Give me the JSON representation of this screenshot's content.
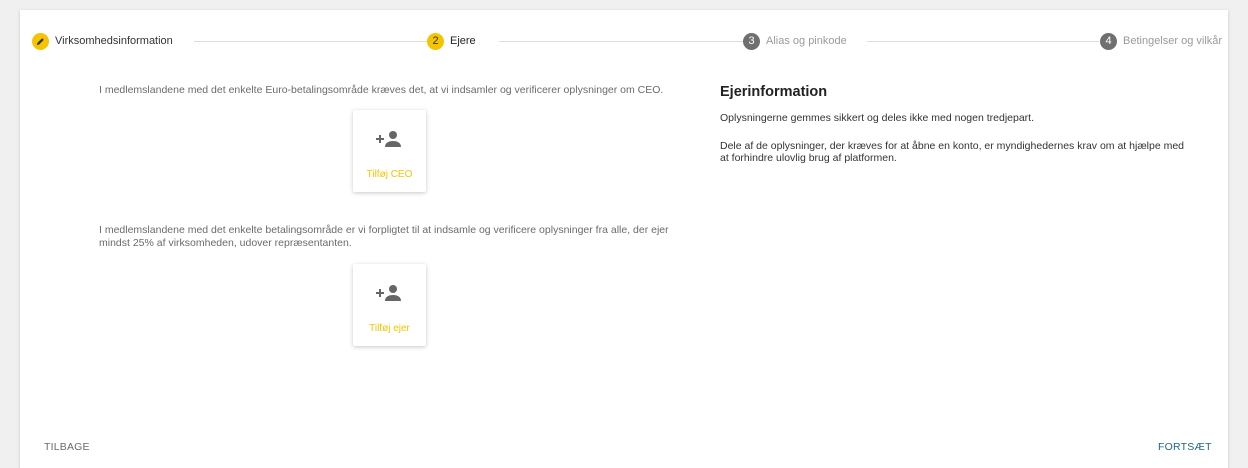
{
  "colors": {
    "accent": "#f5c400",
    "primary_action": "#1a6a80",
    "secondary_action": "#6b6b6b",
    "step_inactive": "#6f6f6f"
  },
  "stepper": {
    "steps": [
      {
        "number": "",
        "label": "Virksomhedsinformation",
        "state": "done",
        "icon": "pencil-icon"
      },
      {
        "number": "2",
        "label": "Ejere",
        "state": "active"
      },
      {
        "number": "3",
        "label": "Alias og pinkode",
        "state": "inactive"
      },
      {
        "number": "4",
        "label": "Betingelser og vilkår",
        "state": "inactive"
      }
    ]
  },
  "main": {
    "ceo_intro": "I medlemslandene med det enkelte Euro-betalingsområde kræves det, at vi indsamler og verificerer oplysninger om CEO.",
    "add_ceo_label": "Tilføj CEO",
    "owner_intro": "I medlemslandene med det enkelte betalingsområde er vi forpligtet til at indsamle og verificere oplysninger fra alle, der ejer mindst 25% af virksomheden, udover repræsentanten.",
    "add_owner_label": "Tilføj ejer",
    "add_icon": "add-person-icon"
  },
  "info": {
    "title": "Ejerinformation",
    "para1": "Oplysningerne gemmes sikkert og deles ikke med nogen tredjepart.",
    "para2": "Dele af de oplysninger, der kræves for at åbne en konto, er myndighedernes krav om at hjælpe med at forhindre ulovlig brug af platformen."
  },
  "footer": {
    "back_label": "TILBAGE",
    "continue_label": "FORTSÆT"
  }
}
